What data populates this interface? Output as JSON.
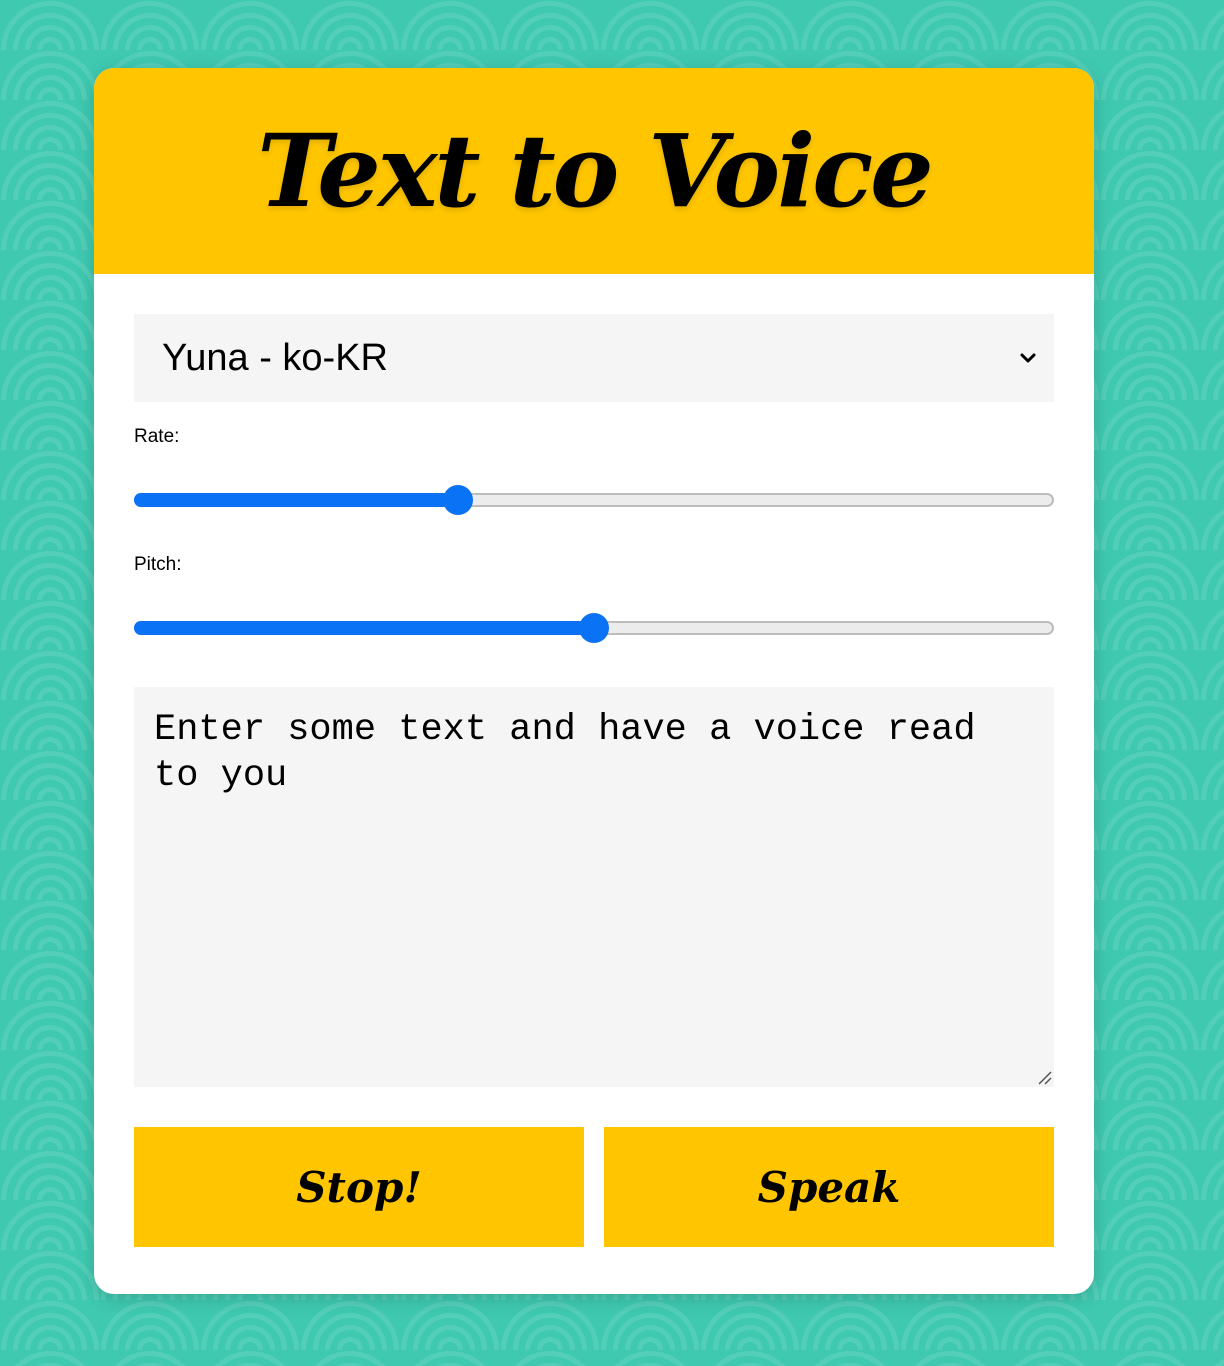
{
  "app": {
    "title": "Text to Voice"
  },
  "voice_select": {
    "selected": "Yuna - ko-KR",
    "icon": "chevron-down-icon"
  },
  "rate": {
    "label": "Rate:",
    "fraction": 0.347
  },
  "pitch": {
    "label": "Pitch:",
    "fraction": 0.5
  },
  "text_input": {
    "placeholder": "Enter some text and have a voice read to you"
  },
  "buttons": {
    "stop_label": "Stop!",
    "speak_label": "Speak"
  },
  "colors": {
    "background": "#3fc9b1",
    "accent": "#ffc600",
    "slider": "#0a72f5",
    "field": "#f5f5f5"
  }
}
